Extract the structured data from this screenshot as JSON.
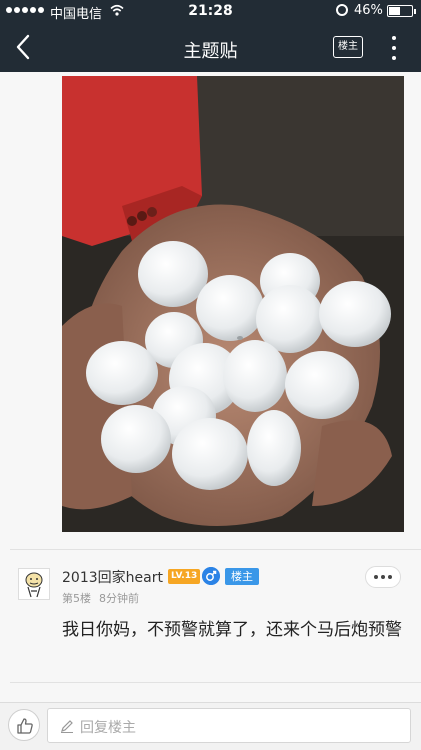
{
  "status_bar": {
    "carrier": "中国电信",
    "time": "21:28",
    "battery": "46%"
  },
  "nav": {
    "title": "主题贴",
    "louzhu_button": "楼主"
  },
  "post": {
    "username": "2013回家heart",
    "level": "LV.13",
    "owner_badge": "楼主",
    "floor": "第5楼",
    "time_ago": "8分钟前",
    "content": "我日你妈，不预警就算了，还来个马后炮预警"
  },
  "bottom_bar": {
    "reply_placeholder": "回复楼主"
  },
  "colors": {
    "nav_bg": "#222c35",
    "accent": "#3a97e8",
    "level_badge": "#f6a623"
  }
}
